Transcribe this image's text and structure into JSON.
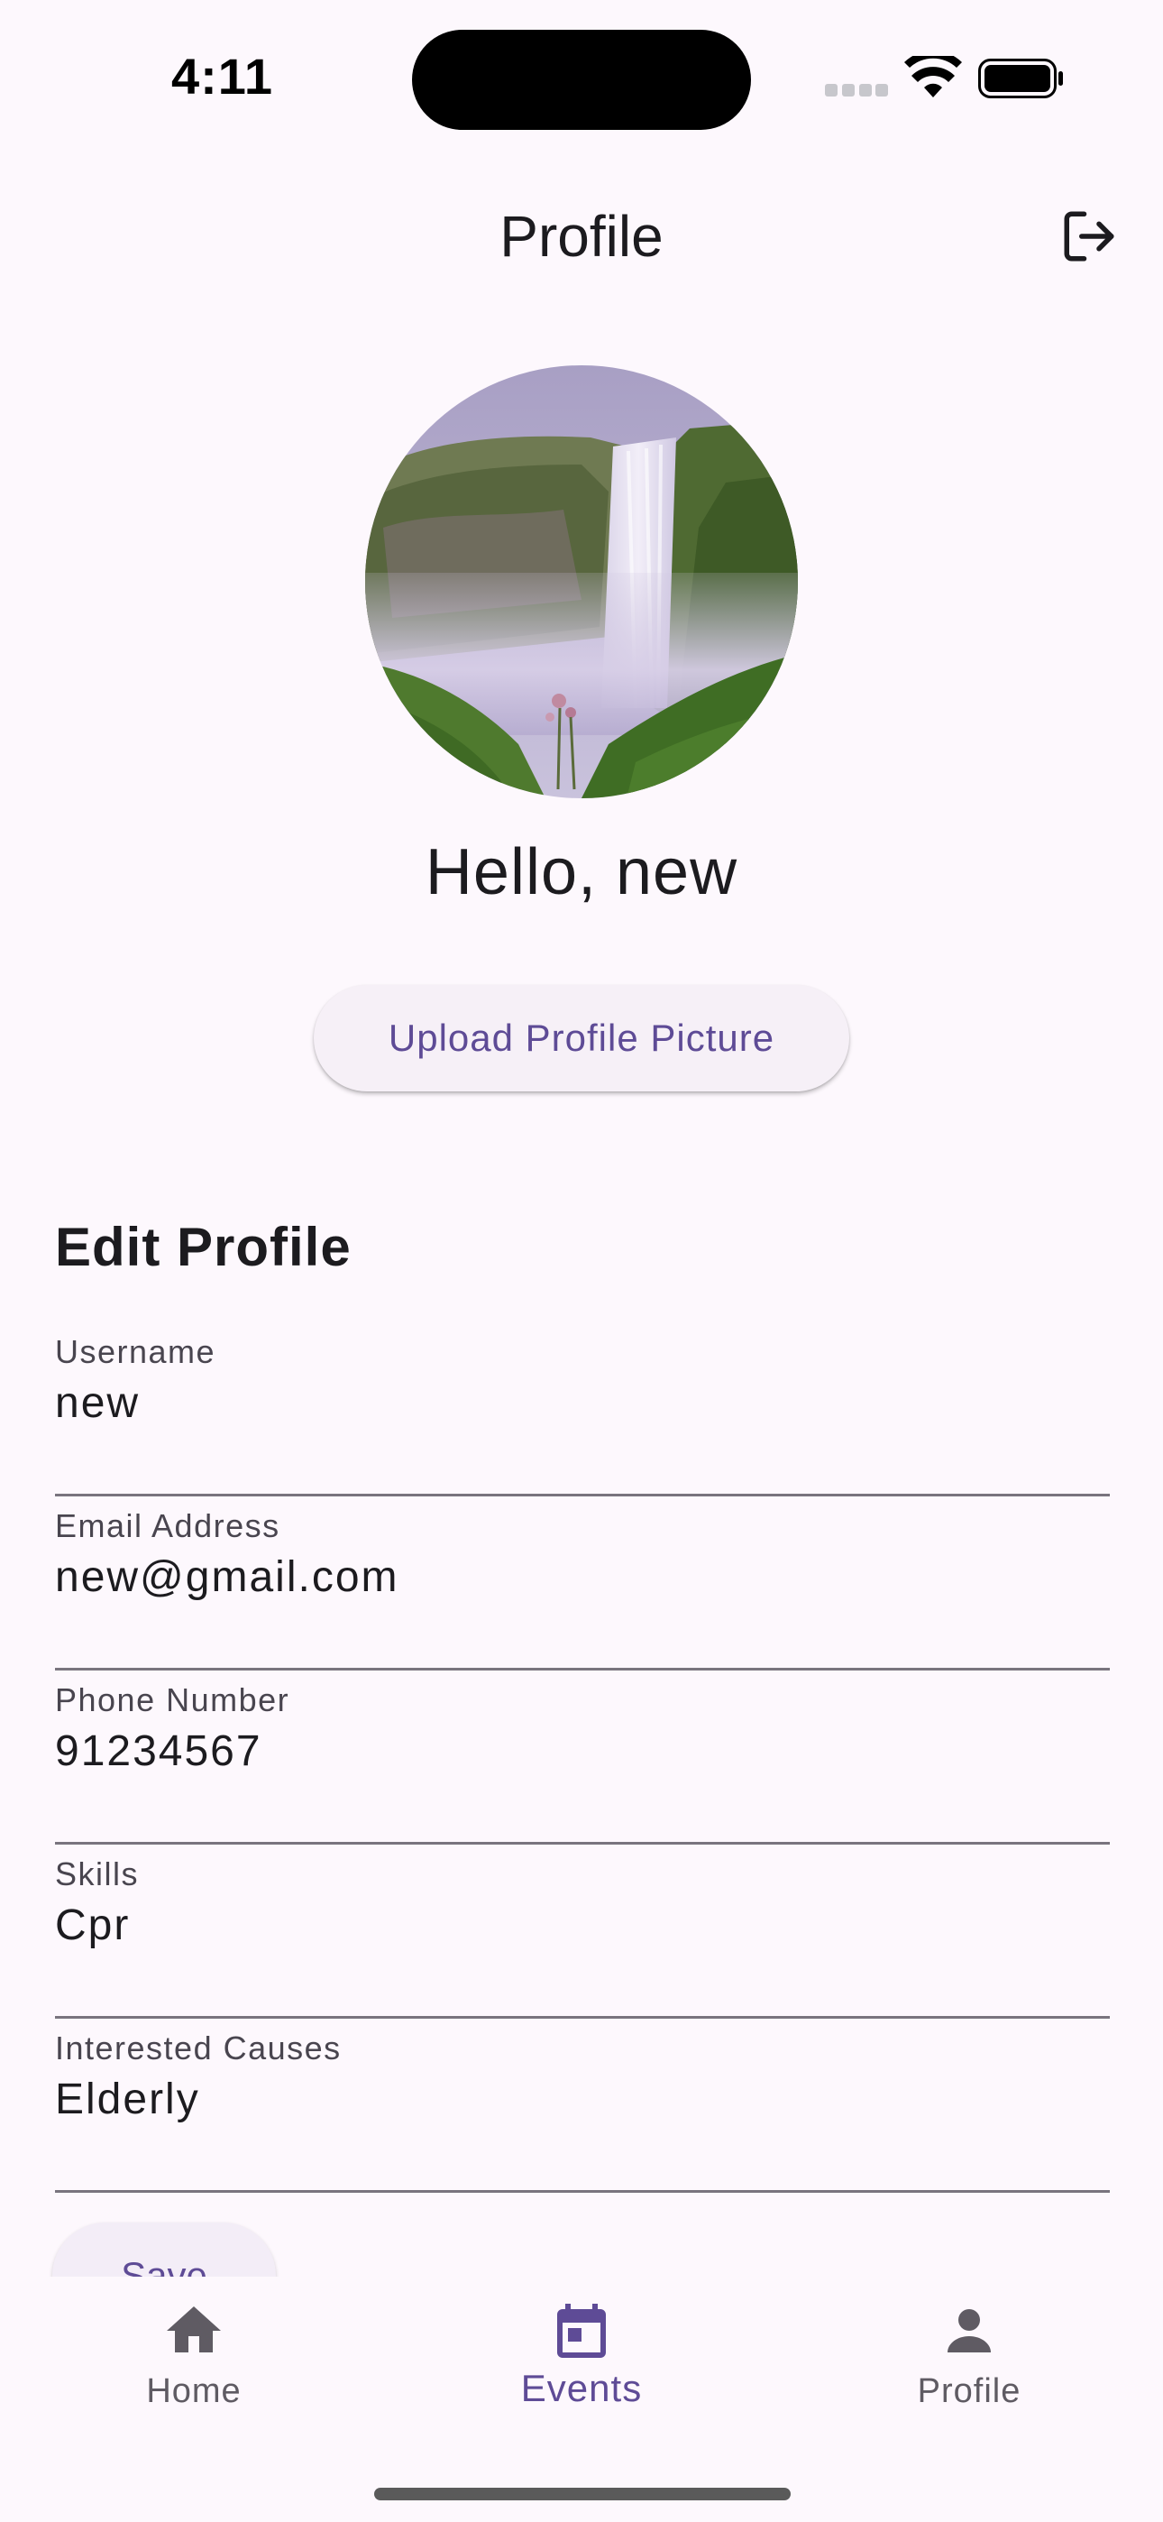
{
  "status_bar": {
    "time": "4:11"
  },
  "app_bar": {
    "title": "Profile",
    "logout_icon": "logout-icon"
  },
  "profile": {
    "greeting": "Hello, new",
    "upload_label": "Upload Profile Picture"
  },
  "form": {
    "title": "Edit Profile",
    "fields": [
      {
        "label": "Username",
        "value": "new"
      },
      {
        "label": "Email Address",
        "value": "new@gmail.com"
      },
      {
        "label": "Phone Number",
        "value": "91234567"
      },
      {
        "label": "Skills",
        "value": "Cpr"
      },
      {
        "label": "Interested Causes",
        "value": "Elderly"
      }
    ],
    "save_label": "Save"
  },
  "bottom_nav": {
    "items": [
      {
        "label": "Home",
        "icon": "home-icon"
      },
      {
        "label": "Events",
        "icon": "calendar-icon"
      },
      {
        "label": "Profile",
        "icon": "person-icon"
      }
    ],
    "active": "Events"
  },
  "colors": {
    "background": "#fdf8fd",
    "accent": "#5e4b96",
    "text": "#1c1b1f",
    "muted": "#49454f",
    "divider": "#79747e"
  }
}
